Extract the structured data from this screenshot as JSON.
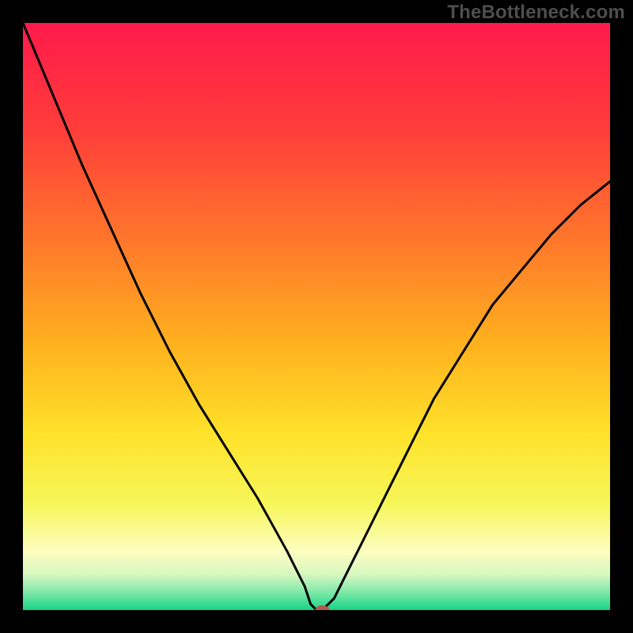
{
  "watermark": "TheBottleneck.com",
  "chart_data": {
    "type": "line",
    "title": "",
    "xlabel": "",
    "ylabel": "",
    "xlim": [
      0,
      100
    ],
    "ylim": [
      0,
      100
    ],
    "grid": false,
    "legend": false,
    "series": [
      {
        "name": "curve",
        "color": "#000000",
        "x": [
          0,
          5,
          10,
          15,
          20,
          25,
          30,
          35,
          40,
          45,
          48,
          49,
          50,
          51,
          53,
          55,
          58,
          62,
          66,
          70,
          75,
          80,
          85,
          90,
          95,
          100
        ],
        "values": [
          100,
          88,
          76,
          65,
          54,
          44,
          35,
          27,
          19,
          10,
          4,
          1,
          0,
          0,
          2,
          6,
          12,
          20,
          28,
          36,
          44,
          52,
          58,
          64,
          69,
          73
        ]
      }
    ],
    "marker": {
      "x": 51,
      "y": 0,
      "color": "#b35a4a",
      "rx": 9,
      "ry": 6
    },
    "background_gradient": {
      "type": "vertical",
      "stops": [
        {
          "offset": 0.0,
          "color": "#ff1a4b"
        },
        {
          "offset": 0.18,
          "color": "#ff3d3a"
        },
        {
          "offset": 0.38,
          "color": "#ff7a2a"
        },
        {
          "offset": 0.55,
          "color": "#ffb21e"
        },
        {
          "offset": 0.7,
          "color": "#ffe22a"
        },
        {
          "offset": 0.82,
          "color": "#f6f65a"
        },
        {
          "offset": 0.9,
          "color": "#fdfec0"
        },
        {
          "offset": 0.94,
          "color": "#d6f7c0"
        },
        {
          "offset": 0.97,
          "color": "#7de8a8"
        },
        {
          "offset": 1.0,
          "color": "#18d487"
        }
      ]
    }
  }
}
